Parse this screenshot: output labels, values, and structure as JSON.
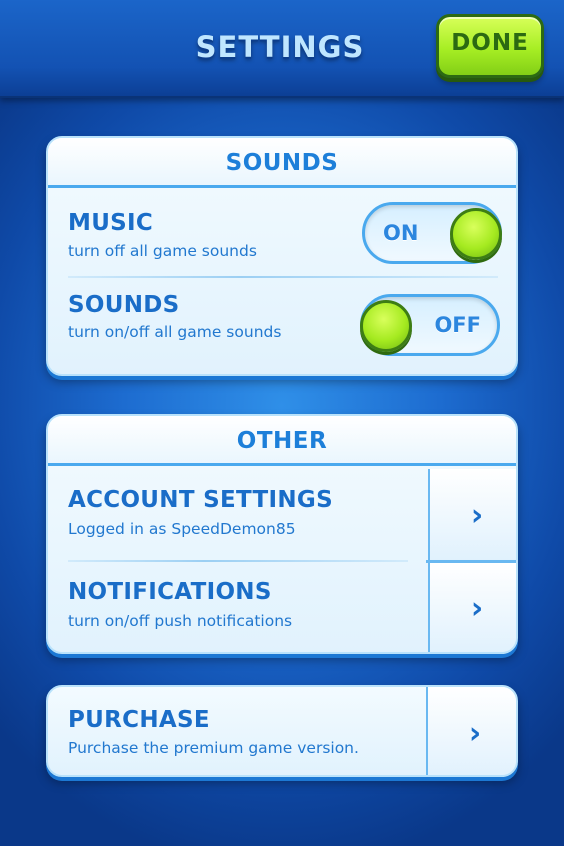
{
  "header": {
    "title": "SETTINGS",
    "done_label": "DONE"
  },
  "sounds_panel": {
    "title": "SOUNDS",
    "music": {
      "title": "MUSIC",
      "subtitle": "turn off all game sounds",
      "toggle_label": "ON",
      "toggle_on": true
    },
    "sounds": {
      "title": "SOUNDS",
      "subtitle": "turn on/off all game sounds",
      "toggle_label": "OFF",
      "toggle_on": false
    }
  },
  "other_panel": {
    "title": "OTHER",
    "account": {
      "title": "ACCOUNT SETTINGS",
      "subtitle": "Logged in as SpeedDemon85",
      "chevron": "›"
    },
    "notifications": {
      "title": "NOTIFICATIONS",
      "subtitle": "turn on/off push notifications",
      "chevron": "›"
    }
  },
  "purchase_panel": {
    "title": "PURCHASE",
    "subtitle": "Purchase the premium game version.",
    "chevron": "›"
  },
  "colors": {
    "accent_blue": "#1a6dc8",
    "button_green": "#a7ee24",
    "background_blue": "#1d6cd0"
  },
  "icons": {
    "chevron": "chevron-right-icon",
    "toggle_knob": "toggle-knob-icon"
  }
}
